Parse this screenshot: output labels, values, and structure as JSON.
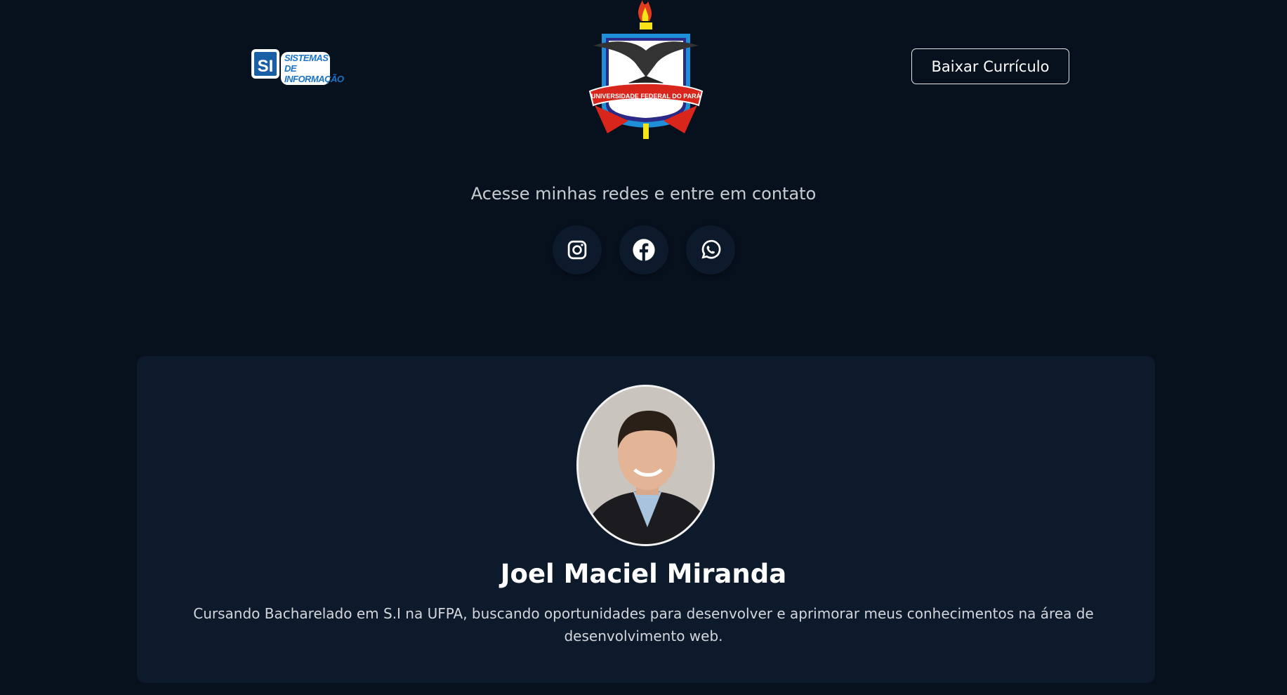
{
  "header": {
    "logo_left_text": "SISTEMAS DE INFORMAÇÃO",
    "logo_left_mark": "SI",
    "logo_center_text": "UNIVERSIDADE FEDERAL DO PARÁ",
    "download_cv_label": "Baixar Currículo"
  },
  "contact": {
    "heading": "Acesse minhas redes e entre em contato",
    "socials": [
      {
        "icon": "instagram-icon"
      },
      {
        "icon": "facebook-icon"
      },
      {
        "icon": "whatsapp-icon"
      }
    ]
  },
  "profile": {
    "name": "Joel Maciel Miranda",
    "description": "Cursando Bacharelado em S.I na UFPA, buscando oportunidades para desenvolver e aprimorar meus conhecimentos na área de desenvolvimento web."
  },
  "colors": {
    "background": "#07111e",
    "card": "#0d1a2b",
    "text": "#ffffff"
  }
}
